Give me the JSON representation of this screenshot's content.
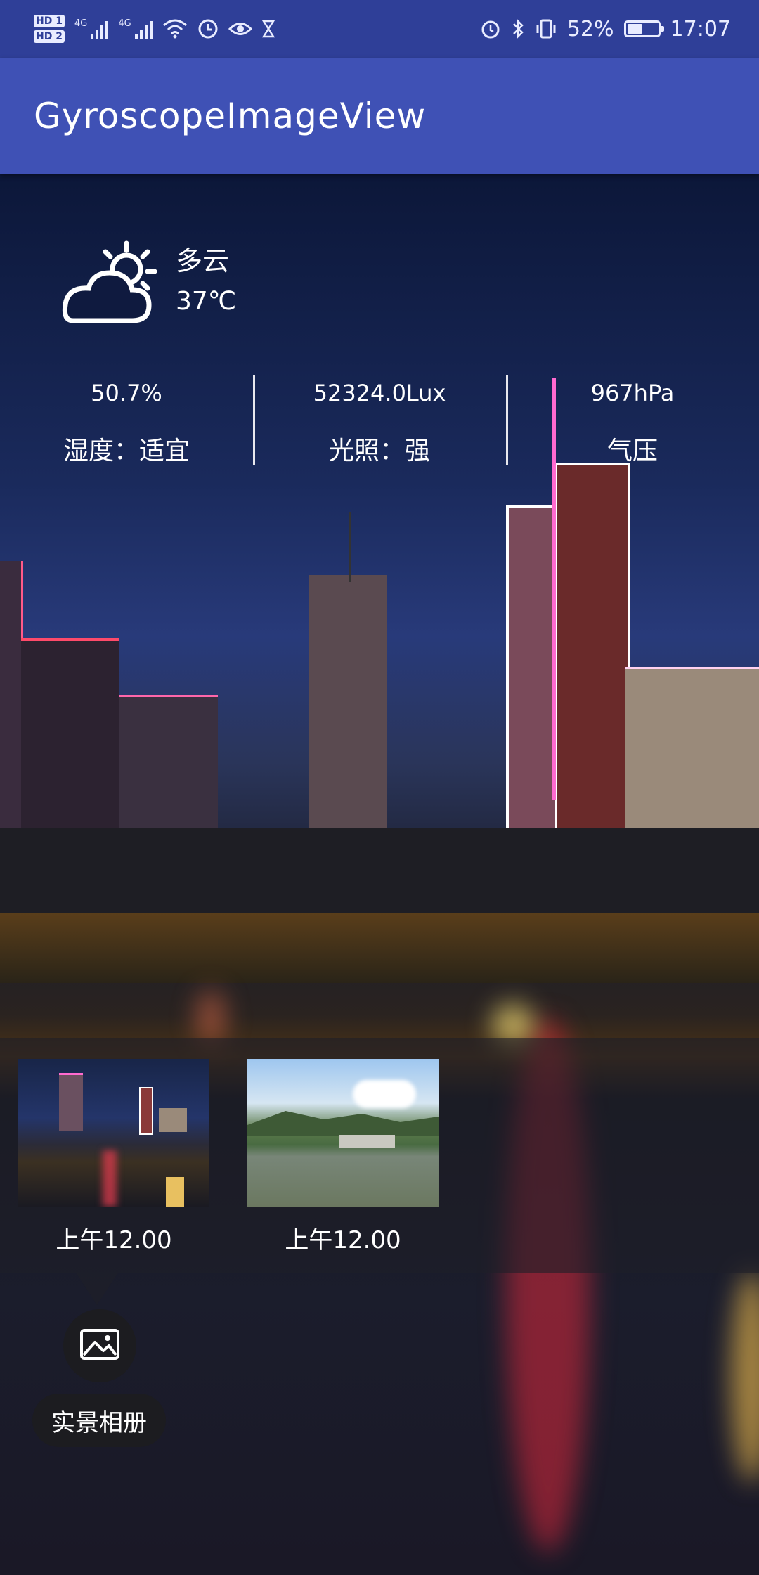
{
  "status_bar": {
    "sim1": "HD 1",
    "sim2": "HD 2",
    "network1": "4G",
    "network2": "4G",
    "battery_percent": "52%",
    "battery_level": 0.52,
    "time": "17:07",
    "icons": [
      "hd-icon",
      "signal-icon",
      "signal-icon",
      "wifi-icon",
      "data-saver-icon",
      "eye-comfort-icon",
      "hourglass-icon",
      "alarm-icon",
      "bluetooth-icon",
      "vibrate-icon",
      "battery-icon"
    ]
  },
  "app_bar": {
    "title": "GyroscopeImageView"
  },
  "weather": {
    "icon": "partly-cloudy-icon",
    "condition": "多云",
    "temperature": "37℃"
  },
  "stats": [
    {
      "value": "50.7%",
      "label": "湿度：适宜"
    },
    {
      "value": "52324.0Lux",
      "label": "光照：强"
    },
    {
      "value": "967hPa",
      "label": "气压"
    }
  ],
  "album": {
    "items": [
      {
        "time": "上午12.00",
        "thumb": "night-city"
      },
      {
        "time": "上午12.00",
        "thumb": "lake-mountain"
      }
    ],
    "button_icon": "image-icon",
    "button_label": "实景相册"
  }
}
